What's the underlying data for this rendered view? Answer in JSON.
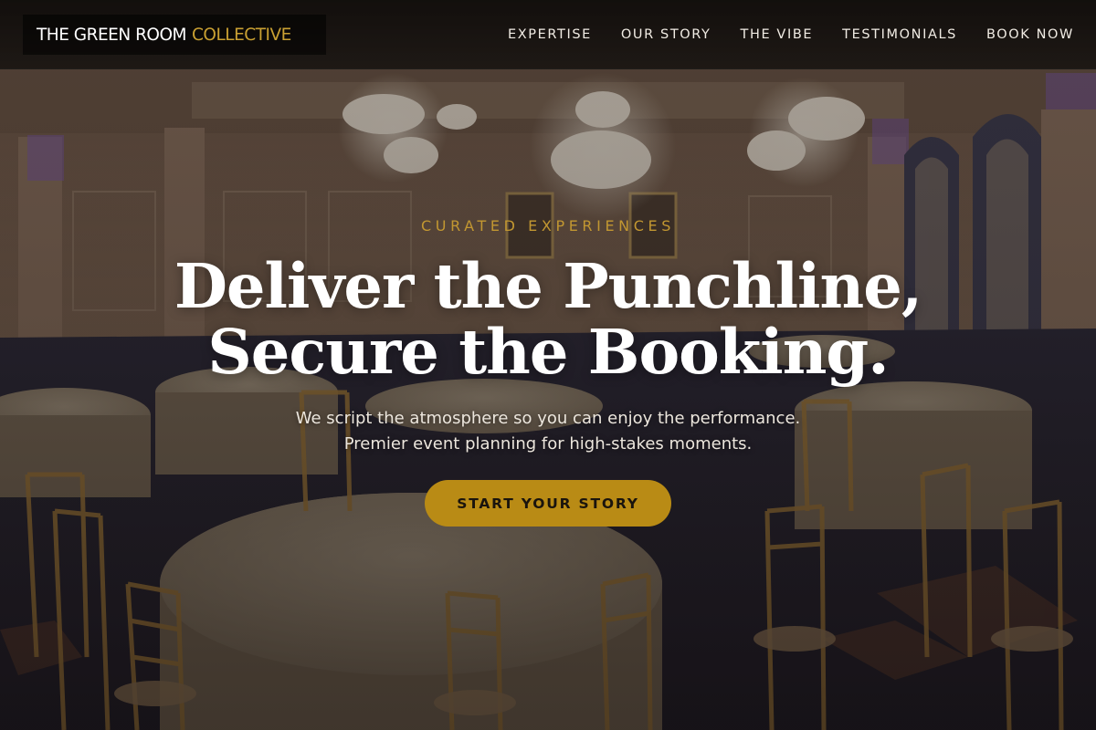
{
  "brand": {
    "name_primary": "THE GREEN ROOM",
    "name_accent": "COLLECTIVE",
    "accent_color": "#c9a032"
  },
  "nav": {
    "items": [
      {
        "label": "EXPERTISE"
      },
      {
        "label": "OUR STORY"
      },
      {
        "label": "THE VIBE"
      },
      {
        "label": "TESTIMONIALS"
      },
      {
        "label": "BOOK NOW"
      }
    ]
  },
  "hero": {
    "eyebrow": "CURATED EXPERIENCES",
    "headline_line1": "Deliver the Punchline,",
    "headline_line2": "Secure the Booking.",
    "subtext_line1": "We script the atmosphere so you can enjoy the performance.",
    "subtext_line2": "Premier event planning for high-stakes moments.",
    "cta_label": "START YOUR STORY",
    "cta_color": "#b98b15"
  }
}
